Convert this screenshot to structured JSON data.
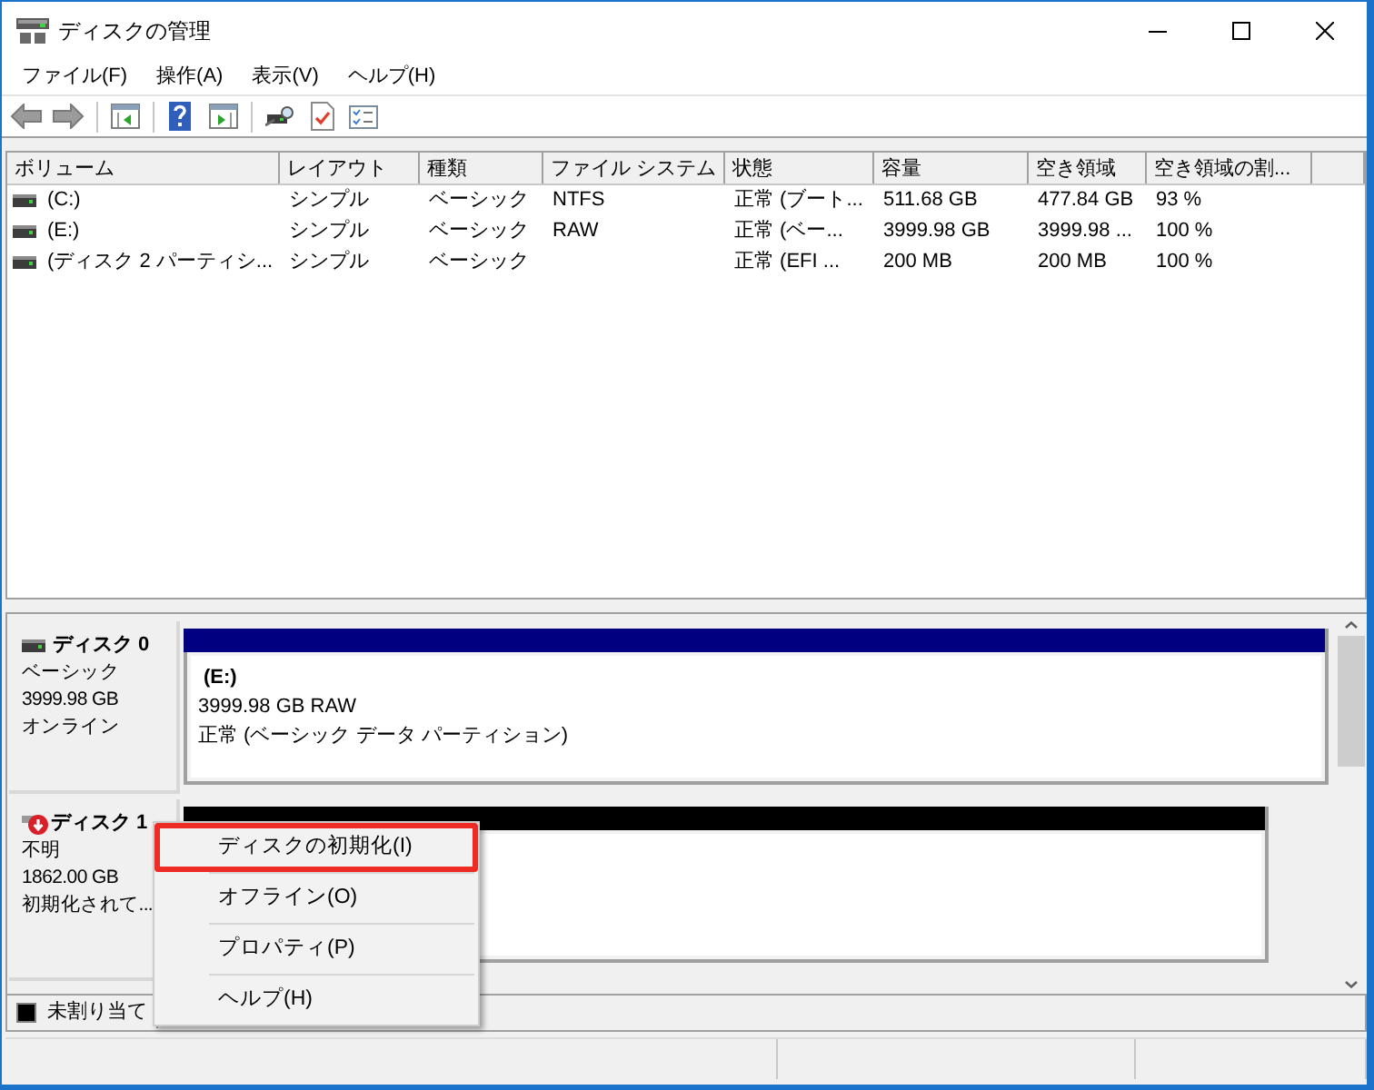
{
  "window": {
    "title": "ディスクの管理"
  },
  "menu_bar": [
    {
      "label": "ファイル(F)"
    },
    {
      "label": "操作(A)"
    },
    {
      "label": "表示(V)"
    },
    {
      "label": "ヘルプ(H)"
    }
  ],
  "volume_table": {
    "columns": [
      "ボリューム",
      "レイアウト",
      "種類",
      "ファイル システム",
      "状態",
      "容量",
      "空き領域",
      "空き領域の割..."
    ],
    "rows": [
      {
        "volume": "(C:)",
        "layout": "シンプル",
        "type": "ベーシック",
        "file_system": "NTFS",
        "status": "正常 (ブート...",
        "capacity": "511.68 GB",
        "free_space": "477.84 GB",
        "percent_free": "93 %"
      },
      {
        "volume": "(E:)",
        "layout": "シンプル",
        "type": "ベーシック",
        "file_system": "RAW",
        "status": "正常 (ベー...",
        "capacity": "3999.98 GB",
        "free_space": "3999.98 ...",
        "percent_free": "100 %"
      },
      {
        "volume": "(ディスク 2 パーティシ...",
        "layout": "シンプル",
        "type": "ベーシック",
        "status": "正常 (EFI ...",
        "capacity": "200 MB",
        "free_space": "200 MB",
        "percent_free": "100 %"
      }
    ]
  },
  "disks": [
    {
      "kind": "online",
      "name": "ディスク 0",
      "type": "ベーシック",
      "size": "3999.98 GB",
      "status": "オンライン",
      "partitions": [
        {
          "kind": "primary",
          "label": "(E:)",
          "size": "3999.98 GB RAW",
          "status": "正常 (ベーシック データ パーティション)"
        }
      ]
    },
    {
      "kind": "not_initialized",
      "name": "ディスク 1",
      "type": "不明",
      "size": "1862.00 GB",
      "status": "初期化されて...",
      "partitions": [
        {
          "kind": "unallocated"
        }
      ]
    }
  ],
  "legend": [
    {
      "label": "未割り当て",
      "color": "#000000"
    }
  ],
  "context_menu": {
    "items": [
      {
        "label": "ディスクの初期化(I)",
        "highlighted": true
      },
      {
        "label": "オフライン(O)",
        "highlighted": false
      },
      {
        "label": "プロパティ(P)",
        "highlighted": false
      },
      {
        "label": "ヘルプ(H)",
        "highlighted": false
      }
    ]
  }
}
